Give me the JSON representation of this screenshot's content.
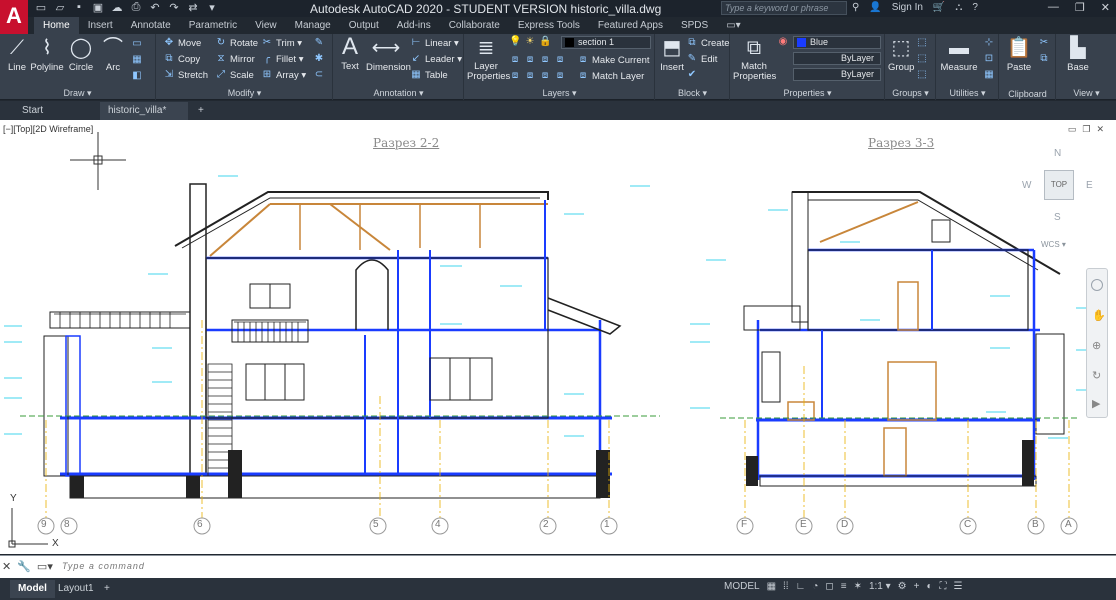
{
  "app": {
    "logo": "A",
    "title": "Autodesk AutoCAD 2020 - STUDENT VERSION    historic_villa.dwg",
    "search_placeholder": "Type a keyword or phrase",
    "sign_in": "Sign In"
  },
  "ribbon_tabs": [
    "Home",
    "Insert",
    "Annotate",
    "Parametric",
    "View",
    "Manage",
    "Output",
    "Add-ins",
    "Collaborate",
    "Express Tools",
    "Featured Apps",
    "SPDS"
  ],
  "panels": {
    "draw": {
      "title": "Draw ▾",
      "line": "Line",
      "polyline": "Polyline",
      "circle": "Circle",
      "arc": "Arc"
    },
    "modify": {
      "title": "Modify ▾",
      "move": "Move",
      "copy": "Copy",
      "stretch": "Stretch",
      "rotate": "Rotate",
      "mirror": "Mirror",
      "scale": "Scale",
      "trim": "Trim ▾",
      "fillet": "Fillet ▾",
      "array": "Array ▾"
    },
    "annotation": {
      "title": "Annotation ▾",
      "text": "Text",
      "dimension": "Dimension",
      "linear": "Linear ▾",
      "leader": "Leader ▾",
      "table": "Table"
    },
    "layers": {
      "title": "Layers ▾",
      "layer_properties": "Layer Properties",
      "current_layer": "section 1",
      "make_current": "Make Current",
      "match_layer": "Match Layer"
    },
    "block": {
      "title": "Block ▾",
      "insert": "Insert",
      "create": "Create",
      "edit": "Edit"
    },
    "properties": {
      "title": "Properties ▾",
      "match_properties": "Match Properties",
      "color": "Blue",
      "linetype": "ByLayer",
      "lineweight": "ByLayer"
    },
    "groups": {
      "title": "Groups ▾",
      "group": "Group"
    },
    "utilities": {
      "title": "Utilities ▾",
      "measure": "Measure"
    },
    "clipboard": {
      "title": "Clipboard",
      "paste": "Paste"
    },
    "view": {
      "title": "View ▾",
      "base": "Base"
    }
  },
  "file_tabs": [
    "Start",
    "historic_villa*"
  ],
  "viewport": {
    "label": "[−][Top][2D Wireframe]",
    "section_left": "Разрез 2-2",
    "section_right": "Разрез 3-3",
    "compass": {
      "n": "N",
      "s": "S",
      "w": "W",
      "e": "E",
      "top": "TOP"
    },
    "wcs": "WCS ▾",
    "axis_y": "Y",
    "axis_x": "X"
  },
  "grid_left": [
    "9",
    "8",
    "6",
    "5",
    "4",
    "2",
    "1"
  ],
  "grid_right": [
    "F",
    "E",
    "D",
    "C",
    "B",
    "A"
  ],
  "command": {
    "placeholder": "Type a command"
  },
  "status": {
    "model": "Model",
    "layout1": "Layout1",
    "mode": "MODEL",
    "scale": "1:1 ▾"
  },
  "colors": {
    "accent_blue": "#1a3cff",
    "cyan_annot": "#00c8e6",
    "wood": "#c8863a"
  }
}
